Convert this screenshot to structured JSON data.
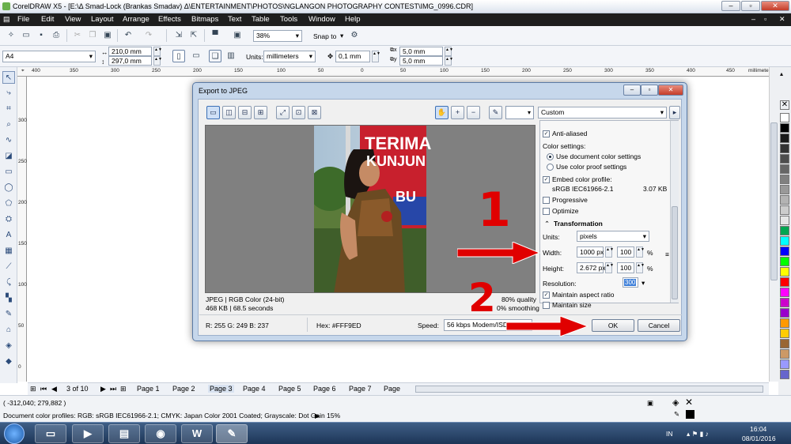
{
  "window": {
    "title": "CorelDRAW X5 - [E:\\Δ Smad-Lock (Brankas Smadav) Δ\\ENTERTAINMENT\\PHOTOS\\NGLANGON PHOTOGRAPHY CONTEST\\IMG_0996.CDR]"
  },
  "menu": [
    "File",
    "Edit",
    "View",
    "Layout",
    "Arrange",
    "Effects",
    "Bitmaps",
    "Text",
    "Table",
    "Tools",
    "Window",
    "Help"
  ],
  "toolbar1": {
    "zoom": "38%",
    "snap_label": "Snap to"
  },
  "toolbar2": {
    "page_size": "A4",
    "width": "210,0 mm",
    "height": "297,0 mm",
    "units_label": "Units:",
    "units": "millimeters",
    "nudge": "0,1 mm",
    "dup_x": "5,0 mm",
    "dup_y": "5,0 mm"
  },
  "ruler": {
    "h_labels": [
      "400",
      "350",
      "300",
      "250",
      "200",
      "150",
      "100",
      "50",
      "0",
      "50",
      "100",
      "150",
      "200",
      "250",
      "300",
      "350",
      "400",
      "450"
    ],
    "unit": "millimeters",
    "v_labels": [
      "300",
      "250",
      "200",
      "150",
      "100",
      "50",
      "0"
    ]
  },
  "pages": {
    "counter": "3 of 10",
    "tabs": [
      "Page 1",
      "Page 2",
      "Page 3",
      "Page 4",
      "Page 5",
      "Page 6",
      "Page 7",
      "Page"
    ]
  },
  "status": {
    "coords": "( -312,040; 279,882 )",
    "profiles": "Document color profiles: RGB: sRGB IEC61966-2.1; CMYK: Japan Color 2001 Coated; Grayscale: Dot Gain 15%"
  },
  "taskbar": {
    "language": "IN",
    "time": "16:04",
    "date": "08/01/2016"
  },
  "dialog": {
    "title": "Export to JPEG",
    "preset": "Custom",
    "photo_sign_line1": "TERIMA",
    "photo_sign_line2": "KUNJUN",
    "photo_sign_line3": "BU",
    "info_format": "JPEG | RGB Color (24-bit)",
    "info_size": "468 KB | 68.5 seconds",
    "quality": "80% quality",
    "smoothing": "0% smoothing",
    "rgb_readout": "R: 255  G: 249  B: 237",
    "hex_readout": "Hex: #FFF9ED",
    "speed_label": "Speed:",
    "speed_value": "56 kbps Modem/ISDN",
    "anti_aliased": "Anti-aliased",
    "color_settings": "Color settings:",
    "use_document": "Use document color settings",
    "use_proof": "Use color proof settings",
    "embed_profile": "Embed color profile:",
    "profile_name": "sRGB IEC61966-2.1",
    "profile_size": "3.07 KB",
    "progressive": "Progressive",
    "optimize": "Optimize",
    "transformation": "Transformation",
    "units_label": "Units:",
    "units_value": "pixels",
    "width_label": "Width:",
    "width_value": "1000 px",
    "width_pct": "100",
    "height_label": "Height:",
    "height_value": "2.672 px",
    "height_pct": "100",
    "percent": "%",
    "resolution_label": "Resolution:",
    "resolution_value": "300",
    "maintain_aspect": "Maintain aspect ratio",
    "maintain_size": "Maintain size",
    "ok": "OK",
    "cancel": "Cancel"
  },
  "annotations": {
    "one": "1",
    "two": "2"
  },
  "colors": {
    "accent_red": "#e00000",
    "menubar": "#1e1e1e",
    "dialog_frame": "#c6d7eb"
  },
  "palette_colors": [
    "#ffffff",
    "#000000",
    "#1a1a1a",
    "#333333",
    "#4d4d4d",
    "#666666",
    "#808080",
    "#999999",
    "#b3b3b3",
    "#cccccc",
    "#e6e6e6",
    "#00a651",
    "#00ffff",
    "#0000ff",
    "#00ff00",
    "#ffff00",
    "#ff0000",
    "#ff00ff",
    "#cc00cc",
    "#9900cc",
    "#ff9900",
    "#ffcc00",
    "#996633",
    "#cc9966",
    "#9999ff",
    "#6666cc"
  ]
}
